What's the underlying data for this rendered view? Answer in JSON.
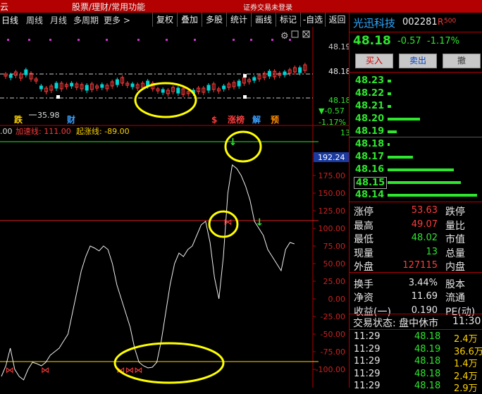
{
  "header": {
    "app_name_partial": "云",
    "title_partial": "股票/理财/常用功能",
    "center_label": "证券交易未登录"
  },
  "period_tabs": [
    {
      "label": "日线",
      "selected": true
    },
    {
      "label": "周线",
      "selected": false
    },
    {
      "label": "月线",
      "selected": false
    },
    {
      "label": "多周期",
      "selected": false
    },
    {
      "label": "更多 >",
      "selected": false
    }
  ],
  "toolbar": [
    {
      "label": "复权"
    },
    {
      "label": "叠加"
    },
    {
      "label": "多股"
    },
    {
      "label": "统计"
    },
    {
      "label": "画线"
    },
    {
      "label": "标记"
    },
    {
      "label": "-自选"
    },
    {
      "label": "返回"
    }
  ],
  "price_panel": {
    "right_axis": [
      "48.19",
      "48.18",
      "48.18"
    ],
    "change_pct_neg": "▼-0.57",
    "pct": "-1.17%",
    "vol_mark": "13",
    "low_label": "35.98",
    "badges": [
      {
        "text": "跌",
        "color": "#ffd400"
      },
      {
        "text": "财",
        "color": "#3aa0ff"
      },
      {
        "text": "$",
        "color": "#ff3b3b"
      },
      {
        "text": "涨榜",
        "color": "#ff3b3b"
      },
      {
        "text": "解",
        "color": "#3aa0ff"
      },
      {
        "text": "预",
        "color": "#ff8c00"
      }
    ]
  },
  "indicator": {
    "left_cut": ".00",
    "accel_label": "加速线: 111.00",
    "start_label": "起涨线: -89.00",
    "current_value": "192.24",
    "axis_ticks": [
      "175.00",
      "150.00",
      "125.00",
      "100.00",
      "75.00",
      "50.00",
      "25.00",
      "0.00",
      "-25.00",
      "-50.00",
      "-75.00",
      "-100.00"
    ],
    "accel_level": 111,
    "start_level": -89,
    "series": [
      -110,
      -95,
      -70,
      -100,
      -110,
      -115,
      -100,
      -90,
      -92,
      -95,
      -90,
      -80,
      -75,
      -70,
      -60,
      -50,
      -20,
      10,
      40,
      60,
      75,
      72,
      68,
      75,
      70,
      50,
      20,
      0,
      -20,
      -40,
      -70,
      -90,
      -95,
      -98,
      -97,
      -90,
      -60,
      -20,
      20,
      50,
      65,
      60,
      70,
      75,
      90,
      105,
      110,
      80,
      30,
      0,
      60,
      150,
      190,
      185,
      175,
      160,
      140,
      110,
      100,
      90,
      70,
      60,
      50,
      40,
      70,
      80,
      78
    ],
    "butterflies": [
      2,
      10,
      27,
      29,
      31
    ],
    "down_arrows": [
      52,
      58
    ]
  },
  "stock": {
    "name": "光迅科技",
    "code": "002281",
    "tag": "R",
    "tag_sup": "500",
    "price": "48.18",
    "change": "-0.57",
    "change_pct": "-1.17%"
  },
  "trade_buttons": {
    "buy": "买入",
    "sell": "卖出",
    "cancel": "撤"
  },
  "orderbook": [
    {
      "price": "48.23",
      "bar": 0.04
    },
    {
      "price": "48.22",
      "bar": 0.04
    },
    {
      "price": "48.21",
      "bar": 0.04
    },
    {
      "price": "48.20",
      "bar": 0.35
    },
    {
      "price": "48.19",
      "bar": 0.1
    },
    {
      "price": "48.18",
      "bar": 0.02
    },
    {
      "price": "48.17",
      "bar": 0.28
    },
    {
      "price": "48.16",
      "bar": 0.72
    },
    {
      "price": "48.15",
      "bar": 0.8
    },
    {
      "price": "48.14",
      "bar": 0.98
    }
  ],
  "stats_left": [
    {
      "label": "涨停",
      "value": "53.63",
      "color": "#ff3b3b"
    },
    {
      "label": "最高",
      "value": "49.07",
      "color": "#ff3b3b"
    },
    {
      "label": "最低",
      "value": "48.02",
      "color": "#2ee62e"
    },
    {
      "label": "现量",
      "value": "13",
      "color": "#2ee62e"
    },
    {
      "label": "外盘",
      "value": "127115",
      "color": "#ff3b3b"
    },
    {
      "label": "换手",
      "value": "3.44%",
      "color": "#e8e8e8"
    },
    {
      "label": "净资",
      "value": "11.69",
      "color": "#e8e8e8"
    },
    {
      "label": "收益(一)",
      "value": "0.190",
      "color": "#e8e8e8"
    }
  ],
  "stats_right": [
    {
      "label": "跌停"
    },
    {
      "label": "量比"
    },
    {
      "label": "市值"
    },
    {
      "label": "总量"
    },
    {
      "label": "内盘"
    },
    {
      "label": "股本"
    },
    {
      "label": "流通"
    },
    {
      "label": "PE(动)"
    }
  ],
  "trade_status": {
    "label": "交易状态: 盘中休市",
    "time": "11:30:"
  },
  "ticks": [
    {
      "time": "11:29",
      "price": "48.18",
      "vol": "2.4万"
    },
    {
      "time": "11:29",
      "price": "48.19",
      "vol": "36.6万"
    },
    {
      "time": "11:29",
      "price": "48.18",
      "vol": "1.4万"
    },
    {
      "time": "11:29",
      "price": "48.18",
      "vol": "2.4万"
    },
    {
      "time": "11:29",
      "price": "48.18",
      "vol": "2.9万"
    }
  ]
}
